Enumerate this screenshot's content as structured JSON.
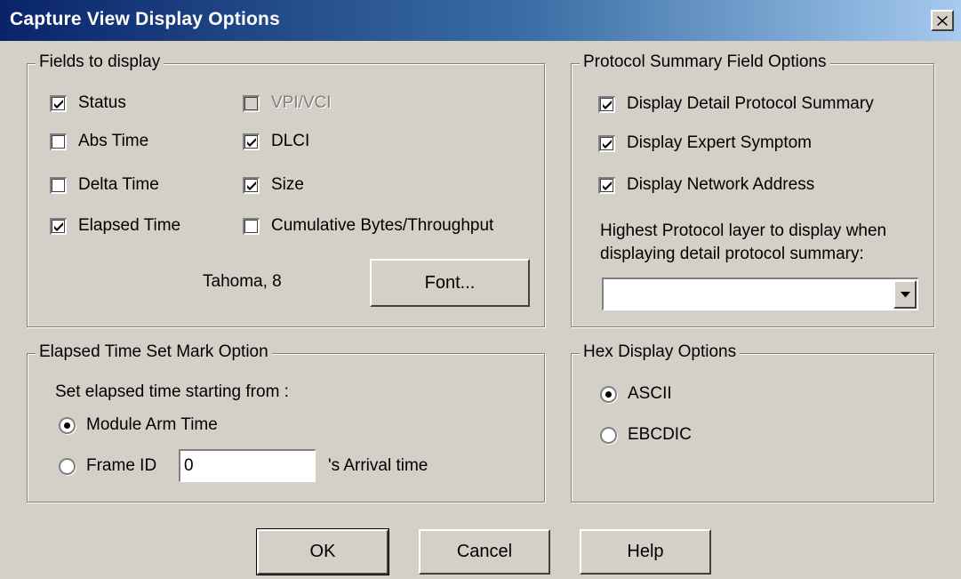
{
  "window": {
    "title": "Capture View Display Options"
  },
  "fields_group": {
    "title": "Fields to display",
    "status": "Status",
    "abs_time": "Abs Time",
    "delta_time": "Delta Time",
    "elapsed_time": "Elapsed Time",
    "vpi_vci": "VPI/VCI",
    "dlci": "DLCI",
    "size": "Size",
    "cumulative": "Cumulative Bytes/Throughput",
    "font_name": "Tahoma, 8",
    "font_button": "Font..."
  },
  "protocol_group": {
    "title": "Protocol Summary Field Options",
    "detail_summary": "Display Detail Protocol Summary",
    "expert_symptom": "Display Expert Symptom",
    "network_address": "Display Network Address",
    "highest_layer_label_1": "Highest Protocol layer to display when",
    "highest_layer_label_2": "displaying detail protocol summary:",
    "highest_layer_value": ""
  },
  "elapsed_group": {
    "title": "Elapsed Time Set Mark Option",
    "prompt": "Set elapsed time starting from :",
    "module_arm": "Module Arm Time",
    "frame_id": "Frame ID",
    "frame_id_value": "0",
    "arrival_suffix": "'s Arrival time"
  },
  "hex_group": {
    "title": "Hex Display Options",
    "ascii": "ASCII",
    "ebcdic": "EBCDIC"
  },
  "buttons": {
    "ok": "OK",
    "cancel": "Cancel",
    "help": "Help"
  },
  "states": {
    "status": true,
    "abs_time": false,
    "delta_time": false,
    "elapsed_time": true,
    "vpi_vci": false,
    "vpi_vci_enabled": false,
    "dlci": true,
    "size": true,
    "cumulative": false,
    "detail_summary": true,
    "expert_symptom": true,
    "network_address": true,
    "elapsed_mark": "module_arm",
    "hex_mode": "ascii"
  },
  "colors": {
    "dialog_bg": "#d4d0c8",
    "title_start": "#0a246a",
    "title_end": "#a6caf0"
  }
}
